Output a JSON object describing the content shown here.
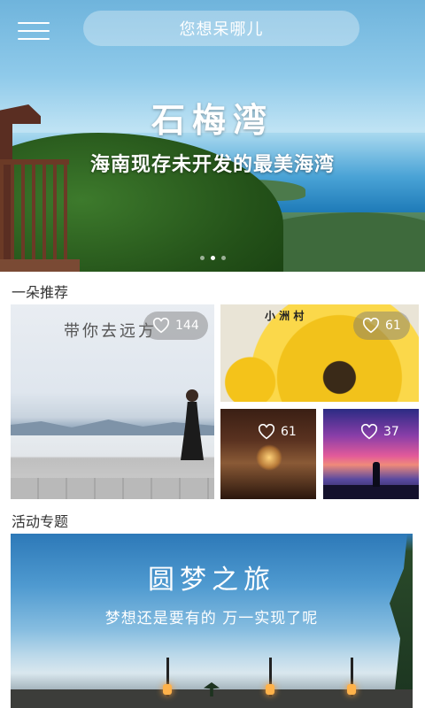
{
  "header": {
    "search_placeholder": "您想呆哪儿"
  },
  "hero": {
    "title": "石梅湾",
    "subtitle": "海南现存未开发的最美海湾",
    "slide_count": 3,
    "active_slide": 2
  },
  "recommend": {
    "section_title": "一朵推荐",
    "cards": [
      {
        "likes": "144",
        "caption": "带你去远方"
      },
      {
        "likes": "61",
        "caption": "小 洲 村"
      },
      {
        "likes": "61"
      },
      {
        "likes": "37"
      }
    ]
  },
  "activity": {
    "section_title": "活动专题",
    "title": "圆梦之旅",
    "subtitle": "梦想还是要有的  万一实现了呢"
  }
}
